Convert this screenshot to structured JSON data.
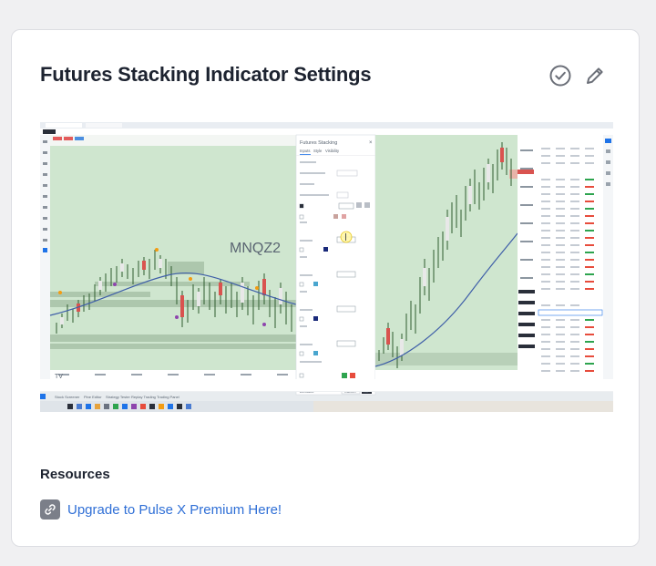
{
  "card": {
    "title": "Futures Stacking Indicator Settings",
    "actions": {
      "complete_icon": "check-circle-icon",
      "edit_icon": "pencil-icon"
    }
  },
  "screenshot": {
    "watermark_symbol": "MNQZ2",
    "watermark_desc": "",
    "dialog": {
      "title": "Futures Stacking",
      "tabs": [
        "Inputs",
        "Style",
        "Visibility"
      ],
      "ok_label": "Ok",
      "cancel_label": "Cancel",
      "defaults_label": "Defaults"
    },
    "bottom_tabs": [
      "Stock Screener",
      "Pine Editor",
      "Strategy Tester",
      "Replay Trading",
      "Trading Panel"
    ]
  },
  "resources": {
    "heading": "Resources",
    "links": [
      {
        "label": "Upgrade to Pulse X Premium Here!",
        "icon": "link-icon"
      }
    ]
  },
  "colors": {
    "link": "#2f6fd6",
    "chart_bg": "#cfe6cf",
    "accent": "#1e73e8"
  }
}
